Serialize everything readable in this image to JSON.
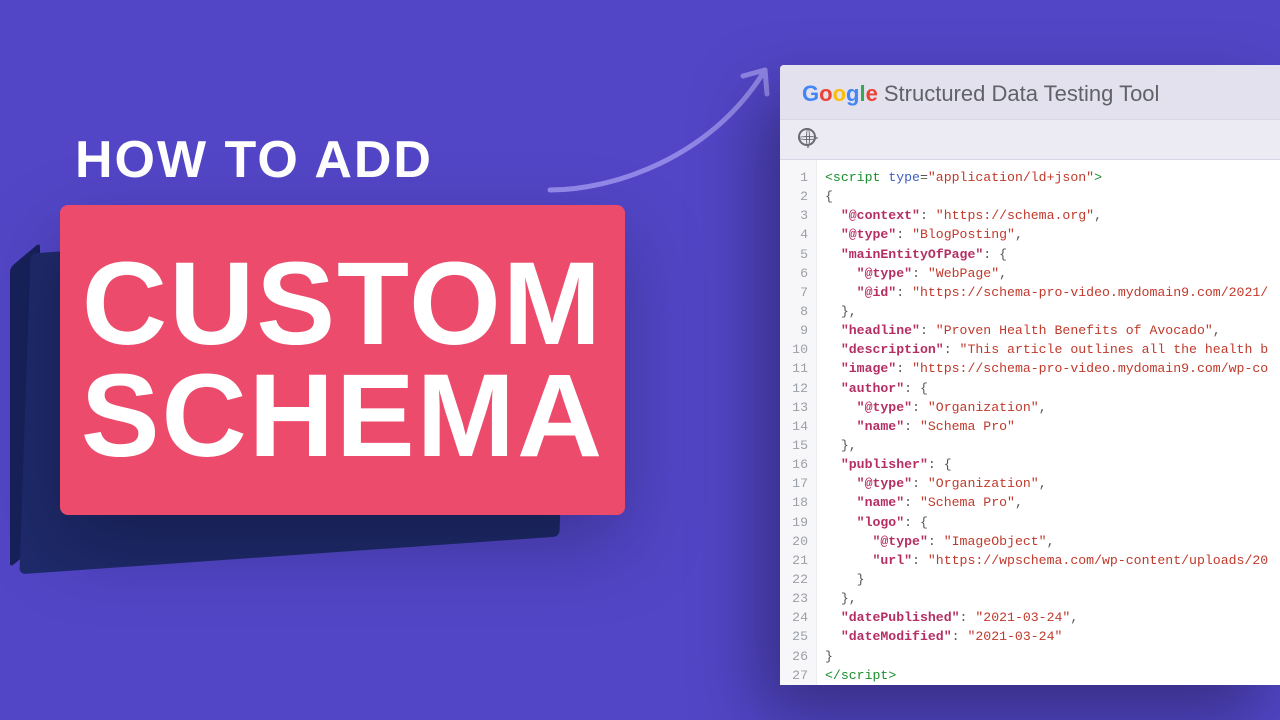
{
  "heading": {
    "line1": "HOW TO ADD",
    "pink1": "CUSTOM",
    "pink2": "SCHEMA"
  },
  "tool": {
    "title": "Structured Data Testing Tool"
  },
  "code": {
    "lines": [
      [
        [
          "tag",
          "<script "
        ],
        [
          "attr",
          "type"
        ],
        [
          "pun",
          "="
        ],
        [
          "str",
          "\"application/ld+json\""
        ],
        [
          "tag",
          ">"
        ]
      ],
      [
        [
          "pun",
          "{"
        ]
      ],
      [
        [
          "pun",
          "  "
        ],
        [
          "key",
          "\"@context\""
        ],
        [
          "pun",
          ": "
        ],
        [
          "str",
          "\"https://schema.org\""
        ],
        [
          "pun",
          ","
        ]
      ],
      [
        [
          "pun",
          "  "
        ],
        [
          "key",
          "\"@type\""
        ],
        [
          "pun",
          ": "
        ],
        [
          "str",
          "\"BlogPosting\""
        ],
        [
          "pun",
          ","
        ]
      ],
      [
        [
          "pun",
          "  "
        ],
        [
          "key",
          "\"mainEntityOfPage\""
        ],
        [
          "pun",
          ": {"
        ]
      ],
      [
        [
          "pun",
          "    "
        ],
        [
          "key",
          "\"@type\""
        ],
        [
          "pun",
          ": "
        ],
        [
          "str",
          "\"WebPage\""
        ],
        [
          "pun",
          ","
        ]
      ],
      [
        [
          "pun",
          "    "
        ],
        [
          "key",
          "\"@id\""
        ],
        [
          "pun",
          ": "
        ],
        [
          "str",
          "\"https://schema-pro-video.mydomain9.com/2021/"
        ]
      ],
      [
        [
          "pun",
          "  },"
        ]
      ],
      [
        [
          "pun",
          "  "
        ],
        [
          "key",
          "\"headline\""
        ],
        [
          "pun",
          ": "
        ],
        [
          "str",
          "\"Proven Health Benefits of Avocado\""
        ],
        [
          "pun",
          ","
        ]
      ],
      [
        [
          "pun",
          "  "
        ],
        [
          "key",
          "\"description\""
        ],
        [
          "pun",
          ": "
        ],
        [
          "str",
          "\"This article outlines all the health b"
        ]
      ],
      [
        [
          "pun",
          "  "
        ],
        [
          "key",
          "\"image\""
        ],
        [
          "pun",
          ": "
        ],
        [
          "str",
          "\"https://schema-pro-video.mydomain9.com/wp-co"
        ]
      ],
      [
        [
          "pun",
          "  "
        ],
        [
          "key",
          "\"author\""
        ],
        [
          "pun",
          ": {"
        ]
      ],
      [
        [
          "pun",
          "    "
        ],
        [
          "key",
          "\"@type\""
        ],
        [
          "pun",
          ": "
        ],
        [
          "str",
          "\"Organization\""
        ],
        [
          "pun",
          ","
        ]
      ],
      [
        [
          "pun",
          "    "
        ],
        [
          "key",
          "\"name\""
        ],
        [
          "pun",
          ": "
        ],
        [
          "str",
          "\"Schema Pro\""
        ]
      ],
      [
        [
          "pun",
          "  },"
        ]
      ],
      [
        [
          "pun",
          "  "
        ],
        [
          "key",
          "\"publisher\""
        ],
        [
          "pun",
          ": {"
        ]
      ],
      [
        [
          "pun",
          "    "
        ],
        [
          "key",
          "\"@type\""
        ],
        [
          "pun",
          ": "
        ],
        [
          "str",
          "\"Organization\""
        ],
        [
          "pun",
          ","
        ]
      ],
      [
        [
          "pun",
          "    "
        ],
        [
          "key",
          "\"name\""
        ],
        [
          "pun",
          ": "
        ],
        [
          "str",
          "\"Schema Pro\""
        ],
        [
          "pun",
          ","
        ]
      ],
      [
        [
          "pun",
          "    "
        ],
        [
          "key",
          "\"logo\""
        ],
        [
          "pun",
          ": {"
        ]
      ],
      [
        [
          "pun",
          "      "
        ],
        [
          "key",
          "\"@type\""
        ],
        [
          "pun",
          ": "
        ],
        [
          "str",
          "\"ImageObject\""
        ],
        [
          "pun",
          ","
        ]
      ],
      [
        [
          "pun",
          "      "
        ],
        [
          "key",
          "\"url\""
        ],
        [
          "pun",
          ": "
        ],
        [
          "str",
          "\"https://wpschema.com/wp-content/uploads/20"
        ]
      ],
      [
        [
          "pun",
          "    }"
        ]
      ],
      [
        [
          "pun",
          "  },"
        ]
      ],
      [
        [
          "pun",
          "  "
        ],
        [
          "key",
          "\"datePublished\""
        ],
        [
          "pun",
          ": "
        ],
        [
          "str",
          "\"2021-03-24\""
        ],
        [
          "pun",
          ","
        ]
      ],
      [
        [
          "pun",
          "  "
        ],
        [
          "key",
          "\"dateModified\""
        ],
        [
          "pun",
          ": "
        ],
        [
          "str",
          "\"2021-03-24\""
        ]
      ],
      [
        [
          "pun",
          "}"
        ]
      ],
      [
        [
          "tag",
          "</scr"
        ],
        [
          "tag",
          "ipt>"
        ]
      ]
    ]
  }
}
